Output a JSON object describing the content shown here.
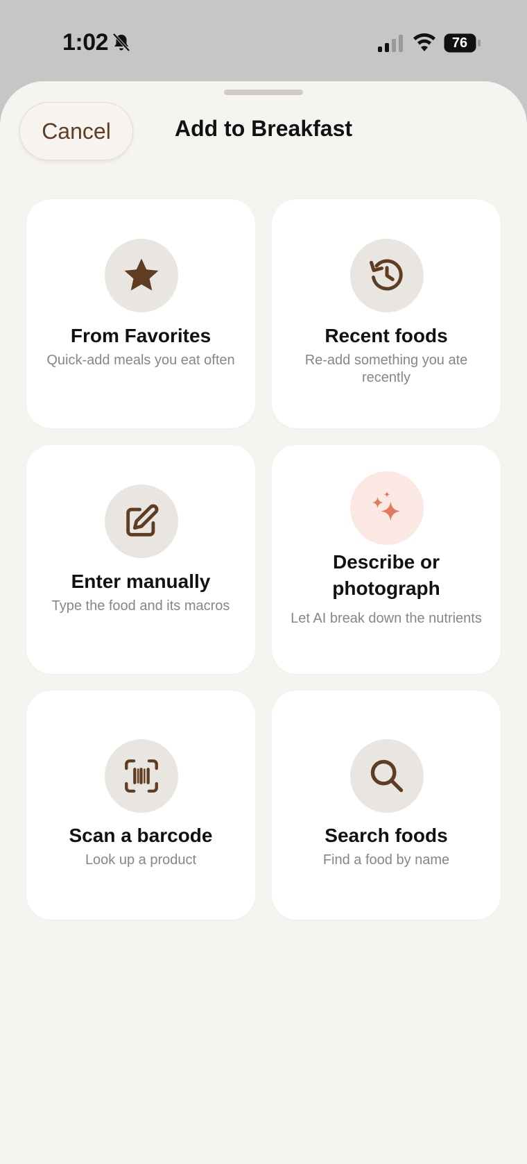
{
  "status_bar": {
    "time": "1:02",
    "battery": "76",
    "icons": [
      "bell-slash-icon",
      "signal-icon",
      "wifi-icon",
      "battery-icon"
    ]
  },
  "header": {
    "cancel_label": "Cancel",
    "title": "Add to Breakfast"
  },
  "options": [
    {
      "title": "From Favorites",
      "subtitle": "Quick-add meals you eat often",
      "icon": "star-icon"
    },
    {
      "title": "Recent foods",
      "subtitle": "Re-add something you ate recently",
      "icon": "history-icon"
    },
    {
      "title": "Enter manually",
      "subtitle": "Type the food and its macros",
      "icon": "edit-icon"
    },
    {
      "title": "Describe or photograph",
      "subtitle": "Let AI break down the nutrients",
      "icon": "sparkles-icon"
    },
    {
      "title": "Scan a barcode",
      "subtitle": "Look up a product",
      "icon": "barcode-scan-icon"
    },
    {
      "title": "Search foods",
      "subtitle": "Find a food by name",
      "icon": "search-icon"
    }
  ],
  "colors": {
    "accent_brown": "#5e3d22",
    "ai_accent": "#e07a5f",
    "sheet_background": "#f6f4f0",
    "card_background": "#ffffff"
  }
}
